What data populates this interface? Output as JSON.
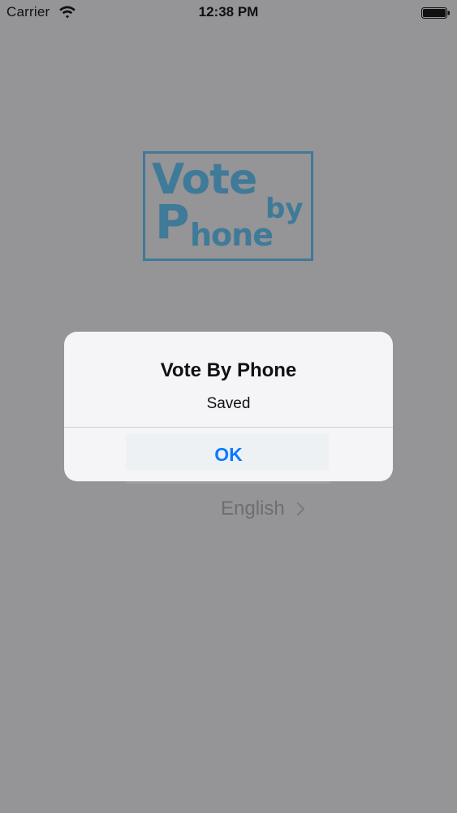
{
  "status_bar": {
    "carrier": "Carrier",
    "time": "12:38 PM",
    "wifi_icon": "wifi-icon",
    "battery_icon": "battery-icon"
  },
  "logo": {
    "line1": "Vote",
    "p": "P",
    "hone": "hone",
    "by": "by",
    "color": "#3f7a99"
  },
  "language": {
    "label": "English",
    "chevron_icon": "chevron-right-icon"
  },
  "alert": {
    "title": "Vote By Phone",
    "message": "Saved",
    "ok_label": "OK",
    "ok_color": "#0a7aff"
  },
  "colors": {
    "dim_background": "#959496",
    "alert_background": "#f5f5f7"
  }
}
